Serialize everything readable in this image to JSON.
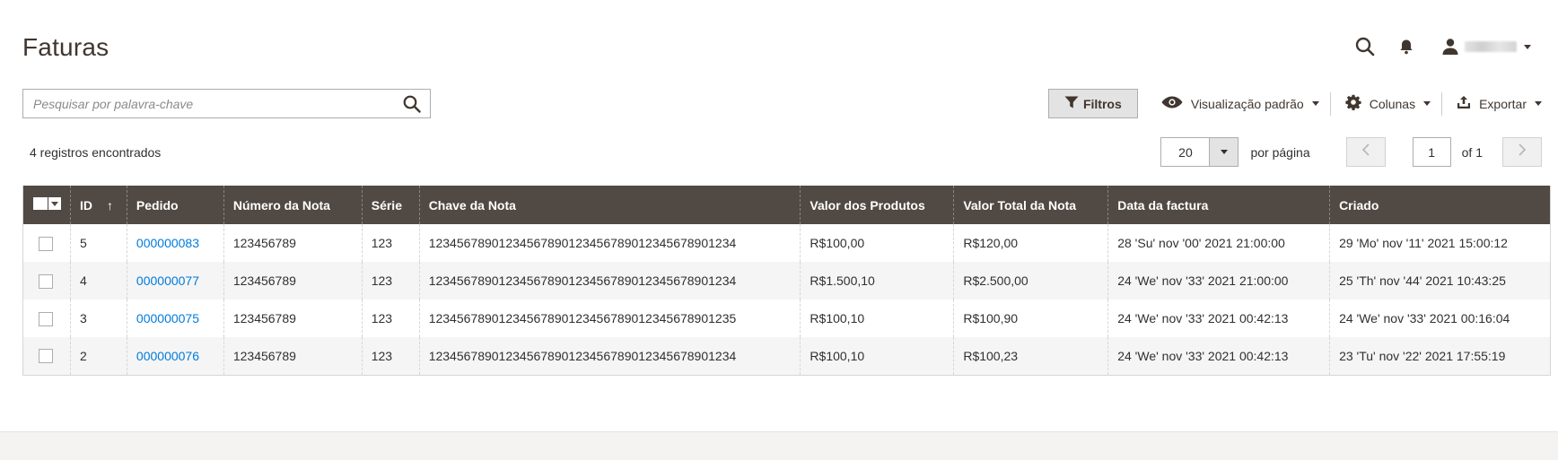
{
  "page": {
    "title": "Faturas"
  },
  "header": {
    "user_caret": "▾"
  },
  "search": {
    "placeholder": "Pesquisar por palavra-chave"
  },
  "toolbar": {
    "filters_label": "Filtros",
    "view_label": "Visualização padrão",
    "columns_label": "Colunas",
    "export_label": "Exportar"
  },
  "records": {
    "text": "4 registros encontrados"
  },
  "pager": {
    "per_page_value": "20",
    "per_page_label": "por página",
    "current_page": "1",
    "of_label": "of 1"
  },
  "table": {
    "headers": {
      "id": "ID",
      "sort_indicator": "↑",
      "pedido": "Pedido",
      "numero": "Número da Nota",
      "serie": "Série",
      "chave": "Chave da Nota",
      "valor_produtos": "Valor dos Produtos",
      "valor_total": "Valor Total da Nota",
      "data": "Data da factura",
      "criado": "Criado"
    },
    "rows": [
      {
        "id": "5",
        "pedido": "000000083",
        "numero": "123456789",
        "serie": "123",
        "chave": "12345678901234567890123456789012345678901234",
        "valor_produtos": "R$100,00",
        "valor_total": "R$120,00",
        "data": "28 'Su' nov '00' 2021 21:00:00",
        "criado": "29 'Mo' nov '11' 2021 15:00:12"
      },
      {
        "id": "4",
        "pedido": "000000077",
        "numero": "123456789",
        "serie": "123",
        "chave": "12345678901234567890123456789012345678901234",
        "valor_produtos": "R$1.500,10",
        "valor_total": "R$2.500,00",
        "data": "24 'We' nov '33' 2021 21:00:00",
        "criado": "25 'Th' nov '44' 2021 10:43:25"
      },
      {
        "id": "3",
        "pedido": "000000075",
        "numero": "123456789",
        "serie": "123",
        "chave": "12345678901234567890123456789012345678901235",
        "valor_produtos": "R$100,10",
        "valor_total": "R$100,90",
        "data": "24 'We' nov '33' 2021 00:42:13",
        "criado": "24 'We' nov '33' 2021 00:16:04"
      },
      {
        "id": "2",
        "pedido": "000000076",
        "numero": "123456789",
        "serie": "123",
        "chave": "12345678901234567890123456789012345678901234",
        "valor_produtos": "R$100,10",
        "valor_total": "R$100,23",
        "data": "24 'We' nov '33' 2021 00:42:13",
        "criado": "23 'Tu' nov '22' 2021 17:55:19"
      }
    ]
  },
  "colors": {
    "header_bg": "#514943",
    "link": "#007bdb",
    "title": "#41362f",
    "button_bg": "#e3e3e3"
  },
  "icons": [
    "search-icon",
    "bell-icon",
    "user-icon",
    "filter-icon",
    "eye-icon",
    "gear-icon",
    "export-icon",
    "chevron-left-icon",
    "chevron-right-icon"
  ]
}
